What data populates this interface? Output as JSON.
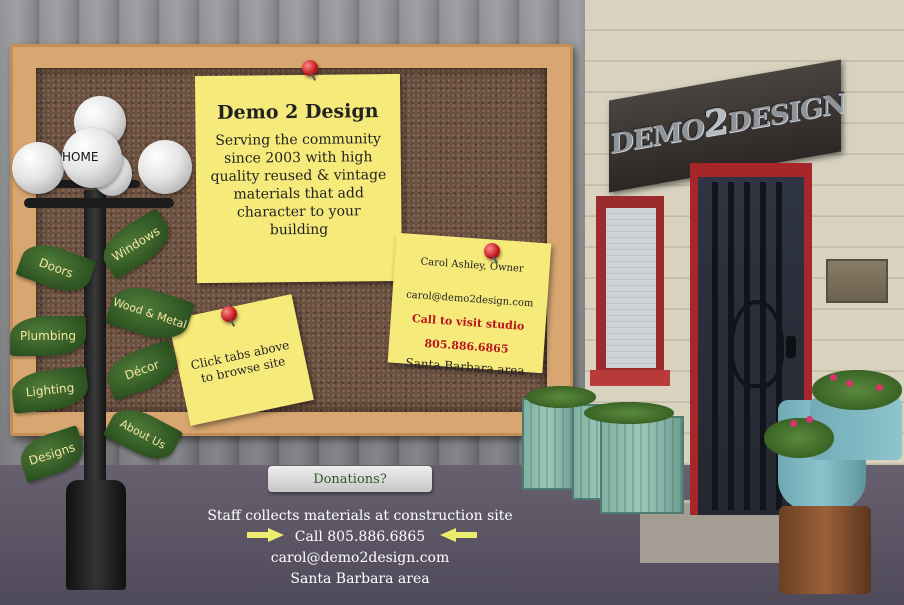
{
  "nav": {
    "home": "HOME",
    "leaves": [
      {
        "label": "Doors"
      },
      {
        "label": "Windows"
      },
      {
        "label": "Wood & Metal"
      },
      {
        "label": "Plumbing"
      },
      {
        "label": "Décor"
      },
      {
        "label": "Lighting"
      },
      {
        "label": "About Us"
      },
      {
        "label": "Designs"
      }
    ]
  },
  "notes": {
    "main_title": "Demo 2 Design",
    "main_body": "Serving the community since 2003 with high quality reused & vintage materials that add character to your building",
    "contact_owner": "Carol Ashley, Owner",
    "contact_email": "carol@demo2design.com",
    "contact_call": "Call to visit studio",
    "contact_phone": "805.886.6865",
    "contact_area": "Santa Barbara area",
    "tabs_hint": "Click tabs above to browse site"
  },
  "sign": {
    "left": "DEMO",
    "mid": "2",
    "right": "DESIGN"
  },
  "donations": "Donations?",
  "footer": {
    "line1": "Staff collects materials at construction site",
    "line2": "Call 805.886.6865",
    "line3": "carol@demo2design.com",
    "line4": "Santa Barbara area"
  },
  "colors": {
    "note": "#f6ea7a",
    "leaf": "#3a6425",
    "leaf_text": "#f3e7a3",
    "call_red": "#b8141e",
    "arrow": "#ecec6e"
  }
}
